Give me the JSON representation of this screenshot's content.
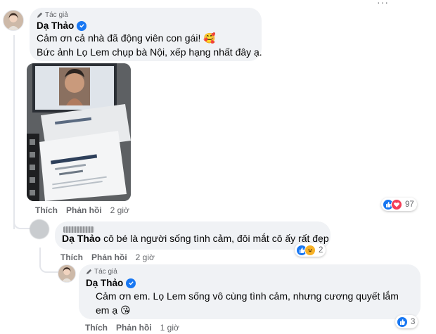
{
  "top_menu": {
    "dots": "···"
  },
  "comment1": {
    "author_tag": "Tác giả",
    "author": "Dạ Thảo",
    "lines": [
      "Cảm ơn cả nhà đã động viên con gái! 🥰",
      "Bức ảnh Lọ Lem chụp bà Nội, xếp hạng nhất đây ạ."
    ],
    "photo_alt": "FIRST PLACE CERTIFICATE",
    "photo_text": {
      "cert_top": "CERTIFICATE of Shortlisting",
      "cert_main": "FIRST PLACE CERTIFICATE",
      "presented": "This is presented to",
      "name": "Pham Linh"
    },
    "actions": {
      "like": "Thích",
      "reply": "Phản hồi",
      "time": "2 giờ"
    },
    "reactions": {
      "icons": [
        "like-icon",
        "love-icon"
      ],
      "count": "97"
    }
  },
  "comment2": {
    "mention": "Dạ Thảo",
    "text": " cô bé là người sống tình cảm, đôi mắt cô ấy rất đẹp",
    "actions": {
      "like": "Thích",
      "reply": "Phản hồi",
      "time": "2 giờ"
    },
    "reactions": {
      "icons": [
        "like-icon",
        "haha-icon"
      ],
      "count": "2"
    }
  },
  "comment3": {
    "author_tag": "Tác giả",
    "author": "Dạ Thảo",
    "lines": [
      "Cảm ơn em. Lọ Lem sống vô cùng tình cảm, nhưng cương quyết lắm",
      "em ạ 😘"
    ],
    "actions": {
      "like": "Thích",
      "reply": "Phản hồi",
      "time": "1 giờ"
    },
    "reactions": {
      "icons": [
        "like-icon"
      ],
      "count": "3"
    }
  },
  "colors": {
    "bubble": "#f0f2f5",
    "meta_text": "#65676b",
    "facebook_blue": "#1877f2",
    "love_red": "#f33e58"
  }
}
